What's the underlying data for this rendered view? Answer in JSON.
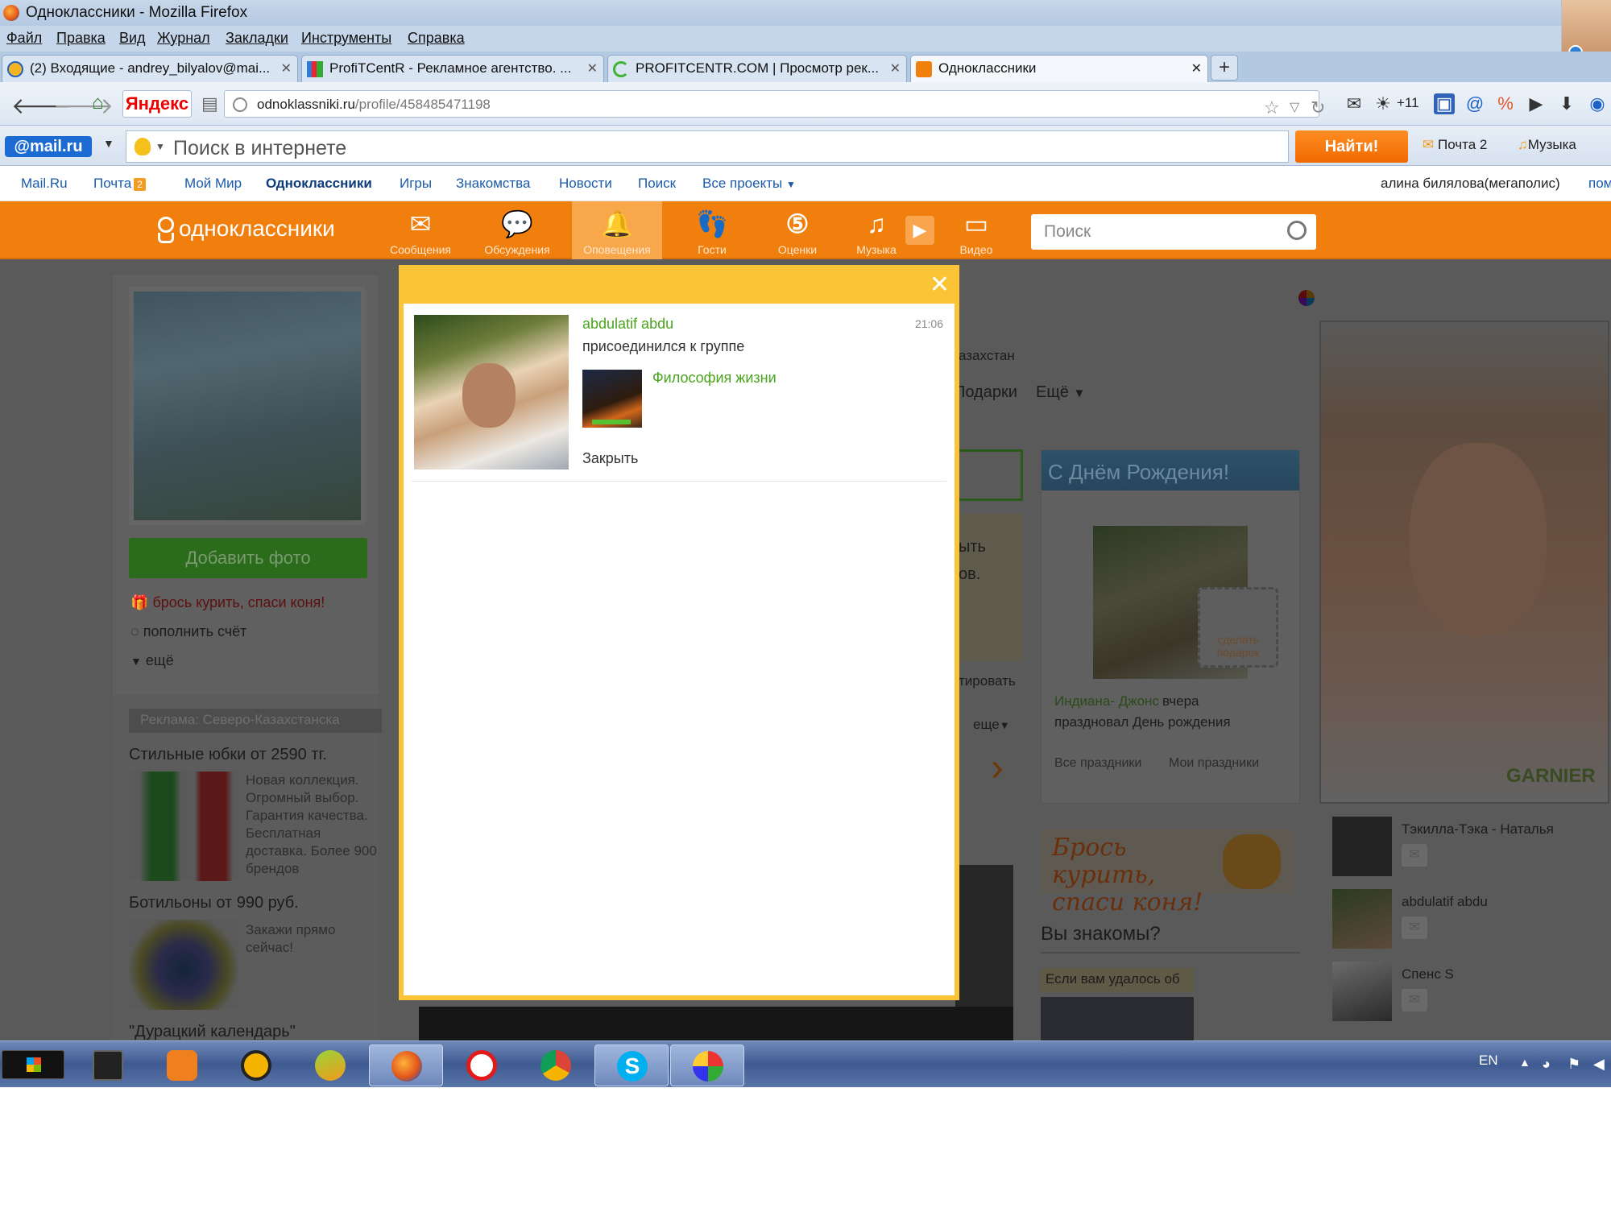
{
  "window": {
    "title": "Одноклассники - Mozilla Firefox"
  },
  "menu": [
    "Файл",
    "Правка",
    "Вид",
    "Журнал",
    "Закладки",
    "Инструменты",
    "Справка"
  ],
  "tabs": [
    {
      "label": "(2) Входящие - andrey_bilyalov@mai...",
      "icon": "mail-icon"
    },
    {
      "label": "ProfiTCentR - Рекламное агентство. ...",
      "icon": "chart-icon"
    },
    {
      "label": "PROFITCENTR.COM | Просмотр рек...",
      "icon": "spinner-icon"
    },
    {
      "label": "Одноклассники",
      "icon": "ok-icon",
      "active": true
    }
  ],
  "nav": {
    "yandex_button": "Яндекс",
    "url_host": "odnoklassniki.ru",
    "url_path": "/profile/458485471198",
    "toolbar_badge": "+11"
  },
  "mailru_bar": {
    "logo": "@mail.ru",
    "search_placeholder": "Поиск в интернете",
    "find_button": "Найти!",
    "mail_item": "Почта 2",
    "music_item": "Музыка"
  },
  "portal": {
    "links": [
      "Mail.Ru",
      "Почта",
      "Мой Мир",
      "Одноклассники",
      "Игры",
      "Знакомства",
      "Новости",
      "Поиск",
      "Все проекты"
    ],
    "mail_badge": "2",
    "user": "алина билялова(мегаполис)",
    "user_more": "пом"
  },
  "ok_header": {
    "logo": "одноклассники",
    "nav": [
      {
        "label": "Сообщения",
        "icon": "envelope-icon"
      },
      {
        "label": "Обсуждения",
        "icon": "chat-bubbles-icon"
      },
      {
        "label": "Оповещения",
        "icon": "bell-icon",
        "active": true
      },
      {
        "label": "Гости",
        "icon": "footprints-icon"
      },
      {
        "label": "Оценки",
        "icon": "rating-5-icon"
      },
      {
        "label": "Музыка",
        "icon": "music-note-icon"
      },
      {
        "label": "Видео",
        "icon": "video-icon"
      }
    ],
    "search_placeholder": "Поиск"
  },
  "profile": {
    "add_photo": "Добавить фото",
    "menu": [
      "брось курить, спаси коня!",
      "пополнить счёт",
      "ещё"
    ],
    "ad_heading": "Реклама: Северо-Казахстанска",
    "ads": [
      {
        "title": "Стильные юбки от 2590 тг.",
        "text": "Новая коллекция. Огромный выбор. Гарантия качества. Бесплатная доставка. Более 900 брендов"
      },
      {
        "title": "Ботильоны от 990 руб.",
        "text": "Закажи прямо сейчас!"
      },
      {
        "title": "\"Дурацкий календарь\""
      }
    ]
  },
  "center": {
    "location_tail": "азахстан",
    "gifts_tab": "Подарки",
    "more_tab": "Ещё",
    "frag1": "ыть",
    "frag2": "ов.",
    "frag3": "тировать",
    "more_link": "еще"
  },
  "birthday": {
    "title": "С Днём Рождения!",
    "gift_button": "сделать подарок",
    "person": "Индиана- Джонс",
    "text_after": "вчера",
    "text_line2": "праздновал День рождения",
    "link_all": "Все праздники",
    "link_mine": "Мои праздники"
  },
  "promo": {
    "text": "Брось курить, спаси коня!"
  },
  "know": {
    "title": "Вы знакомы?",
    "hint": "Если вам удалось об"
  },
  "ad_banner": {
    "brand": "GARNIER"
  },
  "friends": [
    {
      "name": "Тэкилла-Тэка - Наталья"
    },
    {
      "name": "abdulatif abdu"
    },
    {
      "name": "Спенс S"
    }
  ],
  "notification": {
    "user": "abdulatif abdu",
    "time": "21:06",
    "action": "присоединился к группе",
    "group": "Философия жизни",
    "close": "Закрыть"
  },
  "taskbar": {
    "lang": "EN",
    "apps": [
      "window-icon",
      "media-player-icon",
      "aimp-icon",
      "disk-icon",
      "firefox-icon",
      "yandex-browser-icon",
      "chrome-icon",
      "skype-icon",
      "paint-icon"
    ]
  }
}
